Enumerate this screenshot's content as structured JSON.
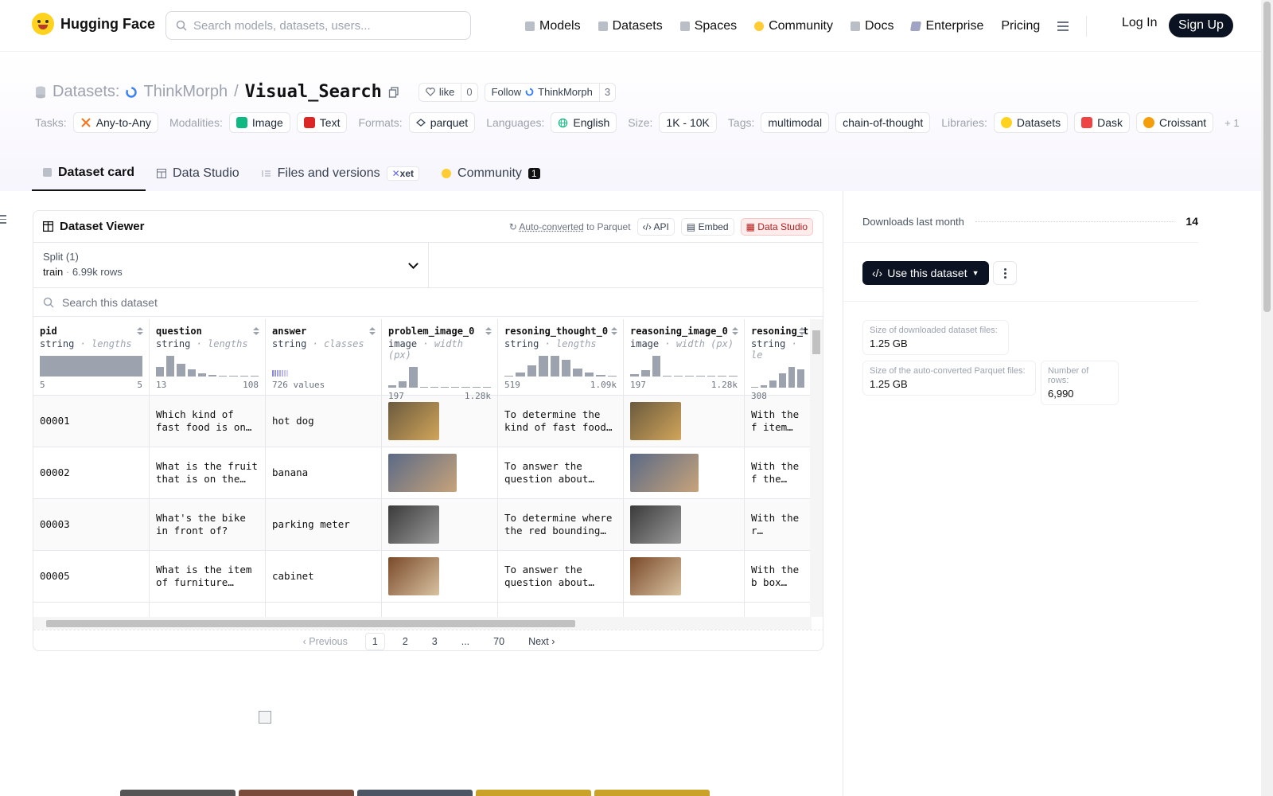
{
  "header": {
    "brand": "Hugging Face",
    "search_placeholder": "Search models, datasets, users...",
    "nav": [
      {
        "label": "Models",
        "icon": "cube-icon"
      },
      {
        "label": "Datasets",
        "icon": "database-icon"
      },
      {
        "label": "Spaces",
        "icon": "grid-icon"
      },
      {
        "label": "Community",
        "icon": "community-icon"
      },
      {
        "label": "Docs",
        "icon": "book-icon"
      },
      {
        "label": "Enterprise",
        "icon": "enterprise-icon"
      },
      {
        "label": "Pricing"
      }
    ],
    "login": "Log In",
    "signup": "Sign Up"
  },
  "dataset": {
    "section": "Datasets:",
    "owner": "ThinkMorph",
    "name": "Visual_Search",
    "like_label": "like",
    "like_count": "0",
    "follow_label": "Follow",
    "follow_org": "ThinkMorph",
    "follow_count": "3"
  },
  "tags": {
    "tasks_label": "Tasks:",
    "tasks": [
      "Any-to-Any"
    ],
    "modalities_label": "Modalities:",
    "modalities": [
      "Image",
      "Text"
    ],
    "formats_label": "Formats:",
    "formats": [
      "parquet"
    ],
    "languages_label": "Languages:",
    "languages": [
      "English"
    ],
    "size_label": "Size:",
    "size": "1K - 10K",
    "tags_label": "Tags:",
    "tags": [
      "multimodal",
      "chain-of-thought"
    ],
    "libraries_label": "Libraries:",
    "libraries": [
      "Datasets",
      "Dask",
      "Croissant"
    ],
    "more": "+ 1"
  },
  "tabs": [
    {
      "label": "Dataset card",
      "active": true
    },
    {
      "label": "Data Studio"
    },
    {
      "label": "Files and versions",
      "badge": "xet"
    },
    {
      "label": "Community",
      "badge": "1"
    }
  ],
  "viewer": {
    "title": "Dataset Viewer",
    "autoconv_link": "Auto-converted",
    "autoconv_rest": "to Parquet",
    "api": "API",
    "embed": "Embed",
    "studio": "Data Studio",
    "split_label": "Split (1)",
    "split_name": "train",
    "split_rows": "6.99k rows",
    "search_placeholder": "Search this dataset",
    "columns": [
      {
        "name": "pid",
        "type": "string",
        "stat": "lengths",
        "min": "5",
        "max": "5",
        "hist": [
          1.0
        ]
      },
      {
        "name": "question",
        "type": "string",
        "stat": "lengths",
        "min": "13",
        "max": "108",
        "hist": [
          0.45,
          1.0,
          0.6,
          0.35,
          0.15,
          0.08,
          0.05,
          0.04,
          0.03,
          0.02
        ]
      },
      {
        "name": "answer",
        "type": "string",
        "stat": "classes",
        "classes_text": "726 values"
      },
      {
        "name": "problem_image_0",
        "type": "image",
        "stat": "width (px)",
        "min": "197",
        "max": "1.28k",
        "hist": [
          0.1,
          0.3,
          1.0,
          0.05,
          0.04,
          0.03,
          0.02,
          0.02,
          0.01,
          0.02
        ]
      },
      {
        "name": "resoning_thought_0",
        "type": "string",
        "stat": "lengths",
        "min": "519",
        "max": "1.09k",
        "hist": [
          0.05,
          0.2,
          0.55,
          1.0,
          1.0,
          0.8,
          0.4,
          0.2,
          0.08,
          0.05
        ]
      },
      {
        "name": "reasoning_image_0",
        "type": "image",
        "stat": "width (px)",
        "min": "197",
        "max": "1.28k",
        "hist": [
          0.1,
          0.3,
          1.0,
          0.05,
          0.04,
          0.03,
          0.02,
          0.02,
          0.01,
          0.02
        ]
      },
      {
        "name": "resoning_t",
        "type": "string",
        "stat": "le",
        "min": "308",
        "max": "",
        "hist": [
          0.05,
          0.1,
          0.35,
          0.7,
          1.0,
          0.9
        ]
      }
    ],
    "rows": [
      {
        "pid": "00001",
        "question": "Which kind of fast food is on the…",
        "answer": "hot dog",
        "reasoning": "To determine the kind of fast food o…",
        "next": "With the f item on th"
      },
      {
        "pid": "00002",
        "question": "What is the fruit that is on the…",
        "answer": "banana",
        "reasoning": "To answer the question about the…",
        "next": "With the f the plate"
      },
      {
        "pid": "00003",
        "question": "What's the bike in front of?",
        "answer": "parking meter",
        "reasoning": "To determine where the red bounding bo…",
        "next": "With the r bounding b"
      },
      {
        "pid": "00005",
        "question": "What is the item of furniture that…",
        "answer": "cabinet",
        "reasoning": "To answer the question about what…",
        "next": "With the b box highli"
      }
    ],
    "pager": {
      "prev": "Previous",
      "pages": [
        "1",
        "2",
        "3",
        "...",
        "70"
      ],
      "next": "Next"
    }
  },
  "sidebar": {
    "downloads_label": "Downloads last month",
    "downloads_value": "14",
    "use_button": "Use this dataset",
    "stats": [
      {
        "label": "Size of downloaded dataset files:",
        "value": "1.25 GB"
      },
      {
        "label": "Size of the auto-converted Parquet files:",
        "value": "1.25 GB"
      },
      {
        "label": "Number of rows:",
        "value": "6,990"
      }
    ]
  },
  "colors": {
    "accent_dark": "#0b1221",
    "studio_red": "#b91c1c",
    "hist_gray": "#9ca3af",
    "classes_purple": "#8b87e0"
  }
}
